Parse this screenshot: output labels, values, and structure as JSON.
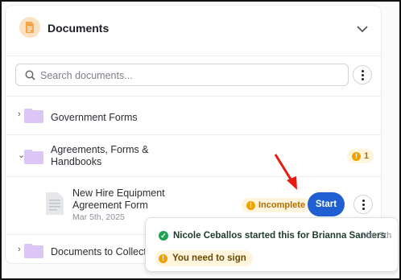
{
  "header": {
    "title": "Documents",
    "doc_icon": "document-icon",
    "toggle_icon": "chevron-down-icon"
  },
  "search": {
    "placeholder": "Search documents...",
    "value": ""
  },
  "folders": [
    {
      "label": "Government Forms",
      "expanded": false
    },
    {
      "label": "Agreements, Forms & Handbooks",
      "expanded": true,
      "count": "1"
    },
    {
      "label": "Documents to Collect",
      "expanded": false
    }
  ],
  "document": {
    "name": "New Hire Equipment Agreement Form",
    "date": "Mar 5th, 2025",
    "status": "Incomplete",
    "action_label": "Start"
  },
  "popover": {
    "activity": "Nicole Ceballos started this for Brianna Sanders",
    "activity_date": "Mar 5th",
    "notice": "You need to sign"
  },
  "colors": {
    "primary": "#1f5fd1",
    "warning": "#f0a000",
    "warning_bg": "#fff4dc",
    "success": "#20a255",
    "folder": "#dcc6f5",
    "arrow": "#e8190f"
  }
}
